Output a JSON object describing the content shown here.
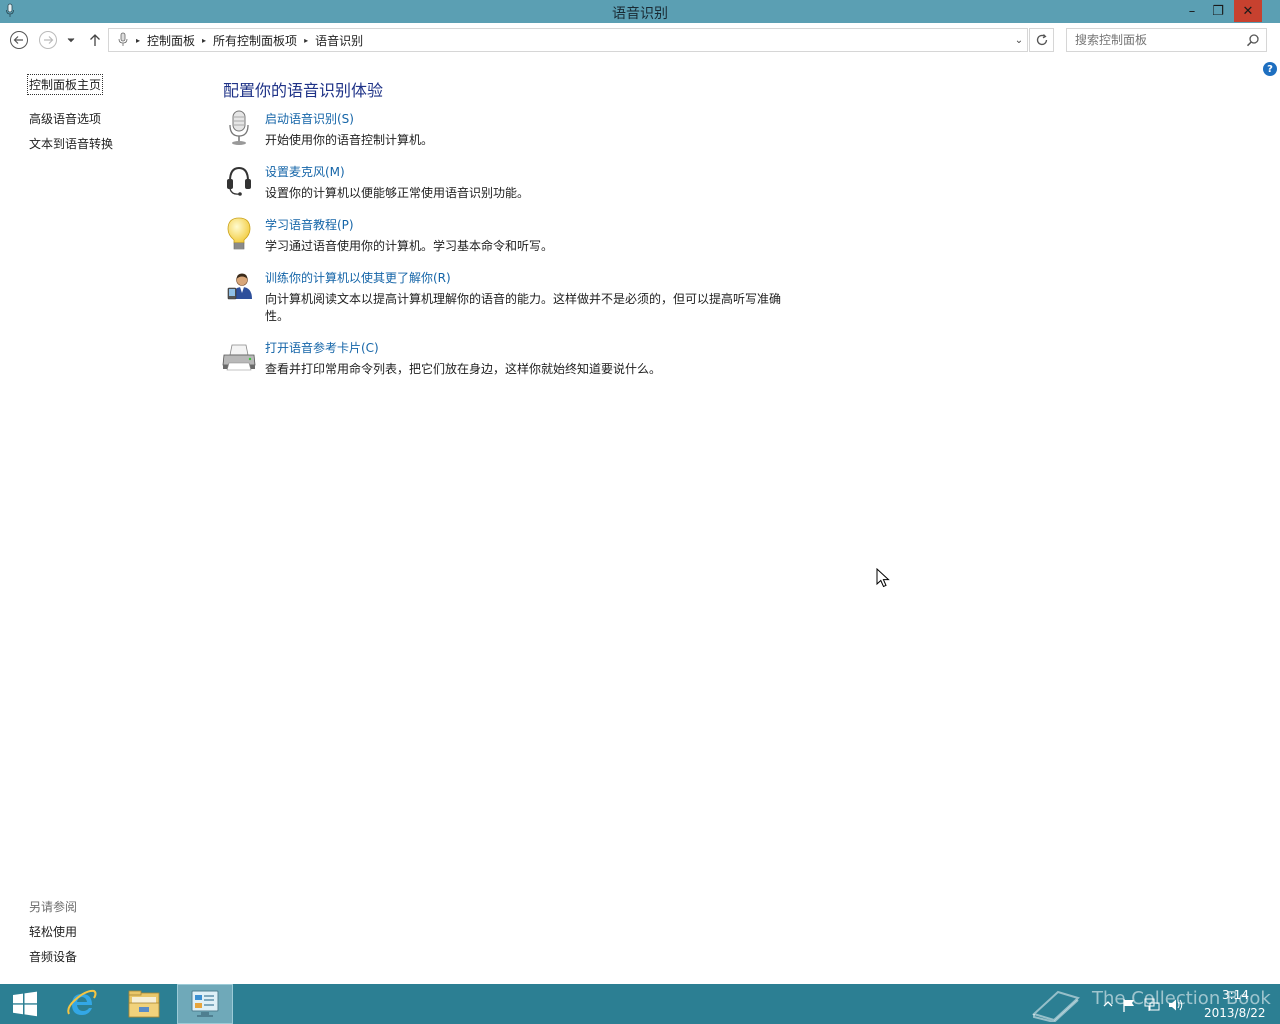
{
  "window": {
    "title": "语音识别",
    "minimize_glyph": "–",
    "maximize_glyph": "❐",
    "close_glyph": "✕"
  },
  "address": {
    "segments": [
      "控制面板",
      "所有控制面板项",
      "语音识别"
    ],
    "separator": "▸",
    "dropdown_glyph": "⌄"
  },
  "search": {
    "placeholder": "搜索控制面板"
  },
  "sidebar": {
    "home": "控制面板主页",
    "items": [
      "高级语音选项",
      "文本到语音转换"
    ],
    "see_also_title": "另请参阅",
    "see_also": [
      "轻松使用",
      "音频设备"
    ]
  },
  "main": {
    "heading": "配置你的语音识别体验",
    "tasks": [
      {
        "icon": "microphone-icon",
        "link": "启动语音识别(S)",
        "desc": "开始使用你的语音控制计算机。"
      },
      {
        "icon": "headset-icon",
        "link": "设置麦克风(M)",
        "desc": "设置你的计算机以便能够正常使用语音识别功能。"
      },
      {
        "icon": "lightbulb-icon",
        "link": "学习语音教程(P)",
        "desc": "学习通过语音使用你的计算机。学习基本命令和听写。"
      },
      {
        "icon": "user-train-icon",
        "link": "训练你的计算机以使其更了解你(R)",
        "desc": "向计算机阅读文本以提高计算机理解你的语音的能力。这样做并不是必须的，但可以提高听写准确性。"
      },
      {
        "icon": "printer-icon",
        "link": "打开语音参考卡片(C)",
        "desc": "查看并打印常用命令列表，把它们放在身边，这样你就始终知道要说什么。"
      }
    ]
  },
  "help": {
    "glyph": "?"
  },
  "taskbar": {
    "watermark": "The Collection Book",
    "clock_time": "3:14",
    "clock_date": "2013/8/22"
  },
  "colors": {
    "titlebar": "#5b9fb3",
    "taskbar": "#2c7f93",
    "link": "#1565a8",
    "heading": "#1e3287",
    "close": "#c7412f"
  }
}
